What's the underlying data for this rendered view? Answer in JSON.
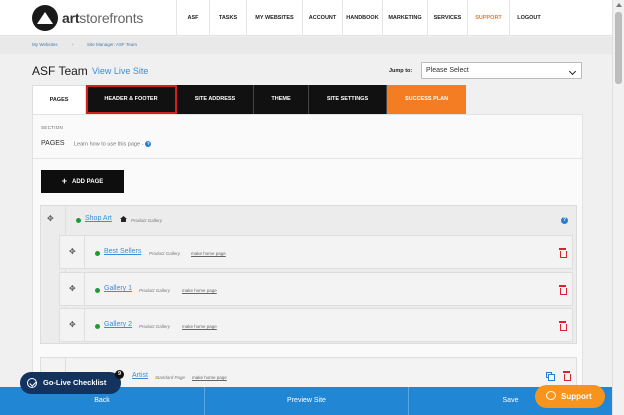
{
  "brand": {
    "name_bold": "art",
    "name_rest": "storefronts"
  },
  "nav": {
    "items": [
      {
        "label": "ASF",
        "w": 33
      },
      {
        "label": "TASKS",
        "w": 37
      },
      {
        "label": "MY WEBSITES",
        "w": 56
      },
      {
        "label": "ACCOUNT",
        "w": 40
      },
      {
        "label": "HANDBOOK",
        "w": 40
      },
      {
        "label": "MARKETING",
        "w": 45
      },
      {
        "label": "SERVICES",
        "w": 40
      },
      {
        "label": "SUPPORT",
        "w": 42
      },
      {
        "label": "LOGOUT",
        "w": 39
      }
    ]
  },
  "breadcrumb": {
    "first": "My Websites",
    "second": "Site Manager: ASF Team"
  },
  "header": {
    "title": "ASF Team",
    "view_live": "View Live Site",
    "jump_label": "Jump to:",
    "jump_value": "Please Select"
  },
  "tabs": [
    {
      "label": "PAGES",
      "w": 54
    },
    {
      "label": "HEADER & FOOTER",
      "w": 91
    },
    {
      "label": "SITE ADDRESS",
      "w": 77
    },
    {
      "label": "THEME",
      "w": 55
    },
    {
      "label": "SITE SETTINGS",
      "w": 78
    },
    {
      "label": "SUCCESS PLAN",
      "w": 79
    }
  ],
  "section": {
    "label": "SECTION",
    "pages": "PAGES",
    "hint": "Learn how to use this page -"
  },
  "add_page": "ADD PAGE",
  "tree": {
    "root": {
      "name": "Shop Art",
      "type": "Product Gallery"
    },
    "children": [
      {
        "name": "Best Sellers",
        "type": "Product Gallery",
        "make_home": "make home page"
      },
      {
        "name": "Gallery 1",
        "type": "Product Gallery",
        "make_home": "make home page"
      },
      {
        "name": "Gallery 2",
        "type": "Product Gallery",
        "make_home": "make home page"
      }
    ],
    "partial": {
      "name": "Artist",
      "type": "Standard Page",
      "make_home": "make home page"
    }
  },
  "bottom": {
    "back": "Back",
    "preview": "Preview Site",
    "save": "Save"
  },
  "checklist": {
    "label": "Go-Live Checklist",
    "badge": "9"
  },
  "support": "Support",
  "colors": {
    "accent_blue": "#2186d3",
    "orange": "#f47c22",
    "nav_dark": "#111111",
    "delete_red": "#d9232e",
    "live_green": "#1e9c2f"
  }
}
